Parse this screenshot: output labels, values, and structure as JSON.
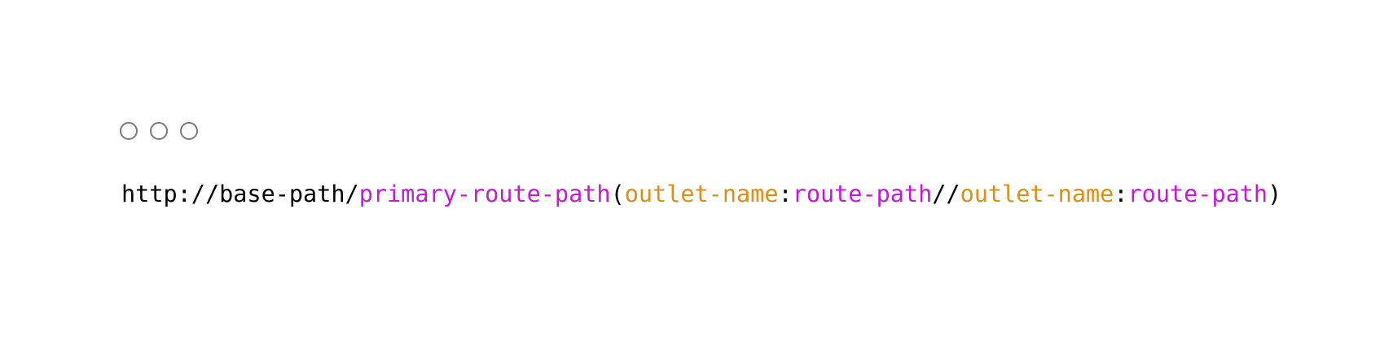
{
  "window_controls": {
    "icons": [
      "window-circle-icon",
      "window-circle-icon",
      "window-circle-icon"
    ],
    "stroke_color": "#7a7a7a"
  },
  "url": {
    "segments": [
      {
        "text": "http://base-path/",
        "role": "base",
        "color": "#000000"
      },
      {
        "text": "primary-route-path",
        "role": "primary-route",
        "color": "#c41ad8"
      },
      {
        "text": "(",
        "role": "punct",
        "color": "#000000"
      },
      {
        "text": "outlet-name",
        "role": "outlet-name",
        "color": "#dd8d1a"
      },
      {
        "text": ":",
        "role": "punct",
        "color": "#000000"
      },
      {
        "text": "route-path",
        "role": "route-path",
        "color": "#c41ad8"
      },
      {
        "text": "//",
        "role": "punct",
        "color": "#000000"
      },
      {
        "text": "outlet-name",
        "role": "outlet-name",
        "color": "#dd8d1a"
      },
      {
        "text": ":",
        "role": "punct",
        "color": "#000000"
      },
      {
        "text": "route-path",
        "role": "route-path",
        "color": "#c41ad8"
      },
      {
        "text": ")",
        "role": "punct",
        "color": "#000000"
      }
    ]
  }
}
